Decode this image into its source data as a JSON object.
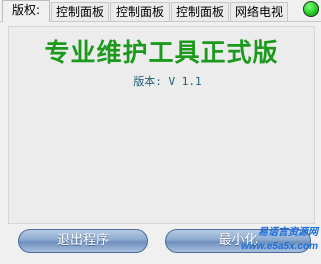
{
  "tabs": [
    {
      "label": "版权:"
    },
    {
      "label": "控制面板"
    },
    {
      "label": "控制面板"
    },
    {
      "label": "控制面板"
    },
    {
      "label": "网络电视"
    }
  ],
  "main": {
    "title": "专业维护工具正式版",
    "version": "版本: V 1.1"
  },
  "buttons": {
    "exit": "退出程序",
    "minimize": "最小化"
  },
  "watermark": {
    "line1": "易语言资源网",
    "line2": "www.e5a5x.com"
  },
  "colors": {
    "title": "#1d9a1d",
    "status_dot": "#1ec51e",
    "button": "#8ba9cf"
  },
  "icons": [
    "status-dot-icon"
  ]
}
